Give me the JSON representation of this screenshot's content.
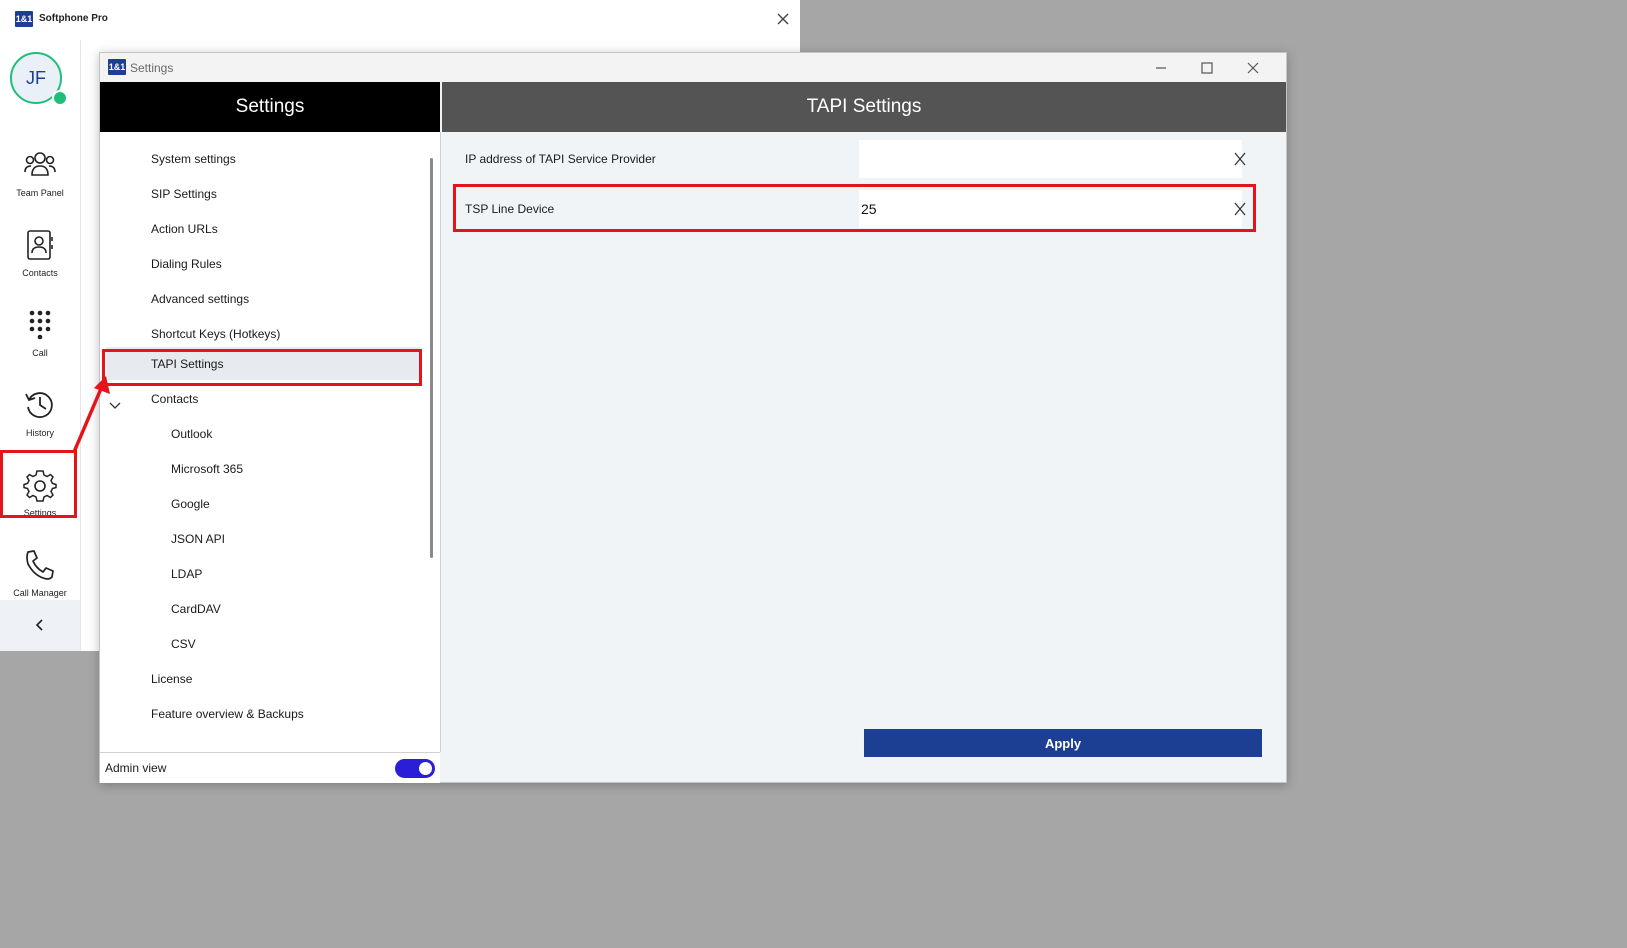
{
  "main_window": {
    "logo_text": "1&1",
    "title": "Softphone Pro"
  },
  "user": {
    "initials": "JF",
    "presence_color": "#1fbf7a"
  },
  "nav_rail": {
    "items": [
      {
        "label": "Team Panel",
        "icon": "team-icon"
      },
      {
        "label": "Contacts",
        "icon": "contacts-icon"
      },
      {
        "label": "Call",
        "icon": "dialpad-icon"
      },
      {
        "label": "History",
        "icon": "history-icon"
      },
      {
        "label": "Settings",
        "icon": "gear-icon",
        "highlighted": true
      },
      {
        "label": "Call Manager",
        "icon": "phone-icon"
      }
    ]
  },
  "settings_window": {
    "title": "Settings",
    "left_header": "Settings",
    "right_header": "TAPI Settings",
    "menu": [
      {
        "label": "System settings",
        "level": 0
      },
      {
        "label": "SIP Settings",
        "level": 0
      },
      {
        "label": "Action URLs",
        "level": 0
      },
      {
        "label": "Dialing Rules",
        "level": 0
      },
      {
        "label": "Advanced settings",
        "level": 0
      },
      {
        "label": "Shortcut Keys (Hotkeys)",
        "level": 0
      },
      {
        "label": "TAPI Settings",
        "level": 0,
        "selected": true
      },
      {
        "label": "Contacts",
        "level": 0,
        "expanded": true
      },
      {
        "label": "Outlook",
        "level": 1
      },
      {
        "label": "Microsoft 365",
        "level": 1
      },
      {
        "label": "Google",
        "level": 1
      },
      {
        "label": "JSON API",
        "level": 1
      },
      {
        "label": "LDAP",
        "level": 1
      },
      {
        "label": "CardDAV",
        "level": 1
      },
      {
        "label": "CSV",
        "level": 1
      },
      {
        "label": "License",
        "level": 0
      },
      {
        "label": "Feature overview & Backups",
        "level": 0
      }
    ],
    "admin_view_label": "Admin view",
    "admin_view_on": true,
    "fields": [
      {
        "label": "IP address of TAPI Service Provider",
        "value": ""
      },
      {
        "label": "TSP Line Device",
        "value": "25"
      }
    ],
    "apply_label": "Apply"
  },
  "colors": {
    "brand": "#1c3f94",
    "highlight": "#e3141b",
    "toggle": "#2a1ed8"
  }
}
